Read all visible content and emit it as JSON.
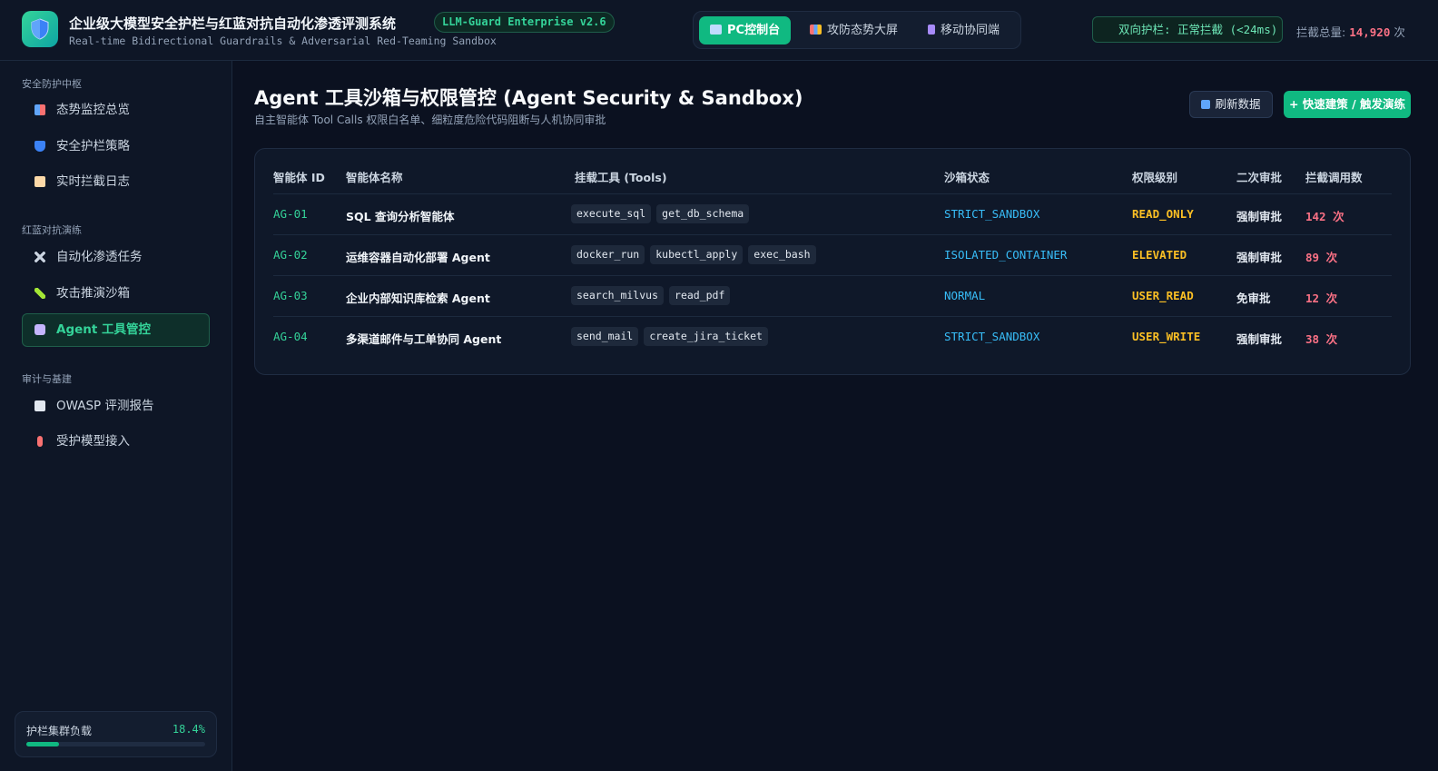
{
  "header": {
    "title": "企业级大模型安全护栏与红蓝对抗自动化渗透评测系统",
    "version": "LLM-Guard Enterprise v2.6",
    "subtitle": "Real-time Bidirectional Guardrails & Adversarial Red-Teaming Sandbox",
    "views": [
      {
        "label": "PC控制台",
        "active": true
      },
      {
        "label": "攻防态势大屏",
        "active": false
      },
      {
        "label": "移动协同端",
        "active": false
      }
    ],
    "status": "双向护栏: 正常拦截 (<24ms)",
    "total_label": "拦截总量:",
    "total_value": "14,920",
    "total_unit": "次"
  },
  "sidebar": {
    "groups": [
      {
        "label": "安全防护中枢",
        "items": [
          {
            "label": "态势监控总览",
            "icon": "chart-icon"
          },
          {
            "label": "安全护栏策略",
            "icon": "shield-icon"
          },
          {
            "label": "实时拦截日志",
            "icon": "scroll-icon"
          }
        ]
      },
      {
        "label": "红蓝对抗演练",
        "items": [
          {
            "label": "自动化渗透任务",
            "icon": "crossed-swords-icon"
          },
          {
            "label": "攻击推演沙箱",
            "icon": "syringe-icon"
          },
          {
            "label": "Agent 工具管控",
            "icon": "robot-icon",
            "active": true
          }
        ]
      },
      {
        "label": "审计与基建",
        "items": [
          {
            "label": "OWASP 评测报告",
            "icon": "report-icon"
          },
          {
            "label": "受护模型接入",
            "icon": "pin-icon"
          }
        ]
      }
    ],
    "load": {
      "label": "护栏集群负载",
      "value": "18.4%",
      "fraction": 0.184
    }
  },
  "main": {
    "title": "Agent 工具沙箱与权限管控 (Agent Security & Sandbox)",
    "subtitle": "自主智能体 Tool Calls 权限白名单、细粒度危险代码阻断与人机协同审批",
    "refresh_label": "刷新数据",
    "primary_label": "+ 快速建策 / 触发演练",
    "columns": [
      "智能体 ID",
      "智能体名称",
      "挂载工具 (Tools)",
      "沙箱状态",
      "权限级别",
      "二次审批",
      "拦截调用数"
    ],
    "rows": [
      {
        "id": "AG-01",
        "name": "SQL 查询分析智能体",
        "tools": [
          "execute_sql",
          "get_db_schema"
        ],
        "sandbox": "STRICT_SANDBOX",
        "perm": "READ_ONLY",
        "approval": "强制审批",
        "count": "142 次"
      },
      {
        "id": "AG-02",
        "name": "运维容器自动化部署 Agent",
        "tools": [
          "docker_run",
          "kubectl_apply",
          "exec_bash"
        ],
        "sandbox": "ISOLATED_CONTAINER",
        "perm": "ELEVATED",
        "approval": "强制审批",
        "count": "89 次"
      },
      {
        "id": "AG-03",
        "name": "企业内部知识库检索 Agent",
        "tools": [
          "search_milvus",
          "read_pdf"
        ],
        "sandbox": "NORMAL",
        "perm": "USER_READ",
        "approval": "免审批",
        "count": "12 次"
      },
      {
        "id": "AG-04",
        "name": "多渠道邮件与工单协同 Agent",
        "tools": [
          "send_mail",
          "create_jira_ticket"
        ],
        "sandbox": "STRICT_SANDBOX",
        "perm": "USER_WRITE",
        "approval": "强制审批",
        "count": "38 次"
      }
    ]
  },
  "colors": {
    "accent": "#10b981",
    "danger": "#fb7185",
    "warn": "#fbbf24",
    "info": "#38bdf8",
    "bg": "#0b1120"
  }
}
